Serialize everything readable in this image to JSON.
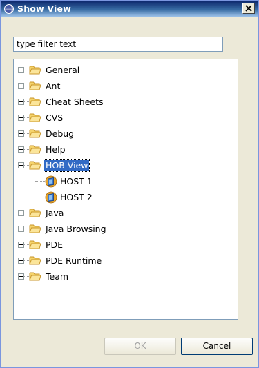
{
  "window": {
    "title": "Show View"
  },
  "filter": {
    "placeholder": "type filter text"
  },
  "tree": {
    "items": [
      {
        "label": "General"
      },
      {
        "label": "Ant"
      },
      {
        "label": "Cheat Sheets"
      },
      {
        "label": "CVS"
      },
      {
        "label": "Debug"
      },
      {
        "label": "Help"
      },
      {
        "label": "HOB View",
        "expanded": true,
        "selected": true,
        "children": [
          {
            "label": "HOST 1"
          },
          {
            "label": "HOST 2"
          }
        ]
      },
      {
        "label": "Java"
      },
      {
        "label": "Java Browsing"
      },
      {
        "label": "PDE"
      },
      {
        "label": "PDE Runtime"
      },
      {
        "label": "Team"
      }
    ]
  },
  "buttons": {
    "ok_label": "OK",
    "cancel_label": "Cancel"
  },
  "colors": {
    "selection": "#316ac5",
    "title_bar": "#0a246a",
    "folder": "#f5d36b"
  }
}
